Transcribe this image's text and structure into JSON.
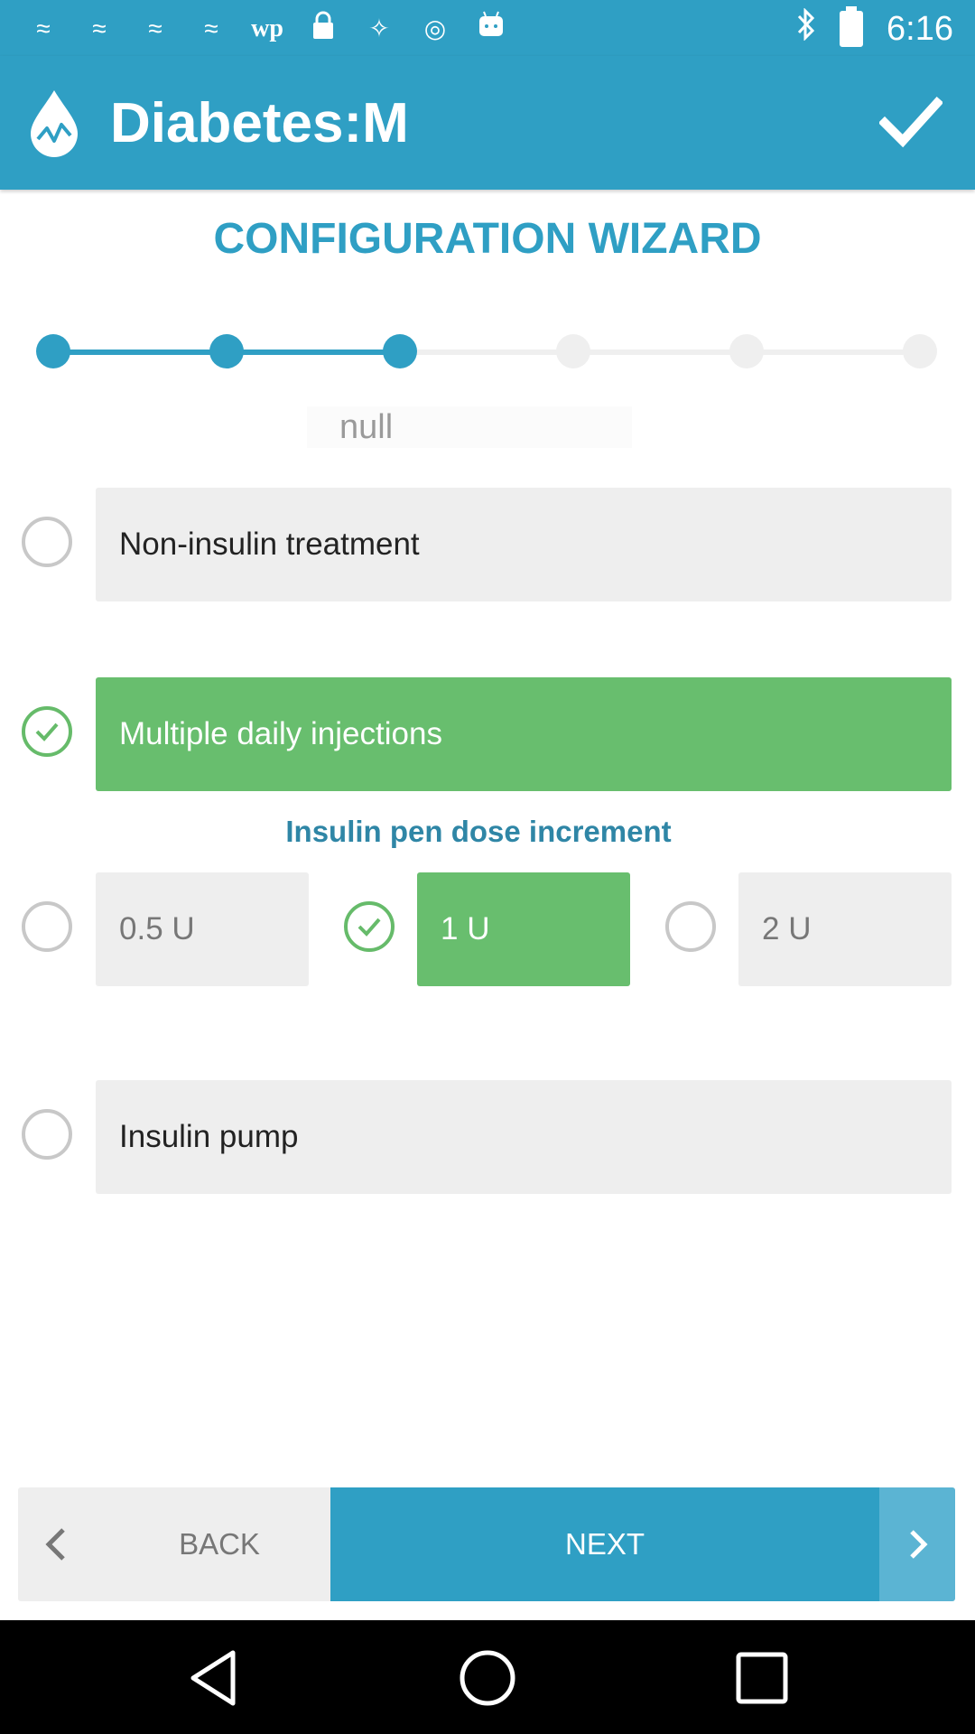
{
  "status_bar": {
    "time": "6:16",
    "left_icons": [
      "signal-app-icon",
      "signal-app-icon",
      "signal-app-icon",
      "signal-app-icon",
      "wp-icon",
      "lock-icon",
      "satellite-icon",
      "record-icon",
      "android-icon"
    ],
    "wp_text": "wp",
    "right_icons": [
      "bluetooth-icon",
      "battery-icon"
    ]
  },
  "app_bar": {
    "title": "Diabetes:M",
    "icons": [
      "drop-logo-icon",
      "check-icon"
    ],
    "color": "#2f9fc4"
  },
  "wizard": {
    "title": "CONFIGURATION WIZARD",
    "progress": {
      "steps_total": 6,
      "steps_done": 3
    },
    "subtitle": "null"
  },
  "options": {
    "non_insulin": {
      "label": "Non-insulin treatment",
      "selected": false
    },
    "multiple_daily": {
      "label": "Multiple daily injections",
      "selected": true
    },
    "pen_heading": "Insulin pen dose increment",
    "increments": [
      {
        "label": "0.5 U",
        "selected": false
      },
      {
        "label": "1 U",
        "selected": true
      },
      {
        "label": "2 U",
        "selected": false
      }
    ],
    "insulin_pump": {
      "label": "Insulin pump",
      "selected": false
    }
  },
  "footer": {
    "back_label": "BACK",
    "next_label": "NEXT",
    "icons": [
      "chevron-left-icon",
      "chevron-right-icon"
    ]
  },
  "nav_bar": {
    "icons": [
      "back-triangle-icon",
      "home-circle-icon",
      "recents-square-icon"
    ]
  },
  "colors": {
    "accent": "#2f9fc4",
    "selected_green": "#68be6e",
    "option_grey": "#eeeeee"
  }
}
